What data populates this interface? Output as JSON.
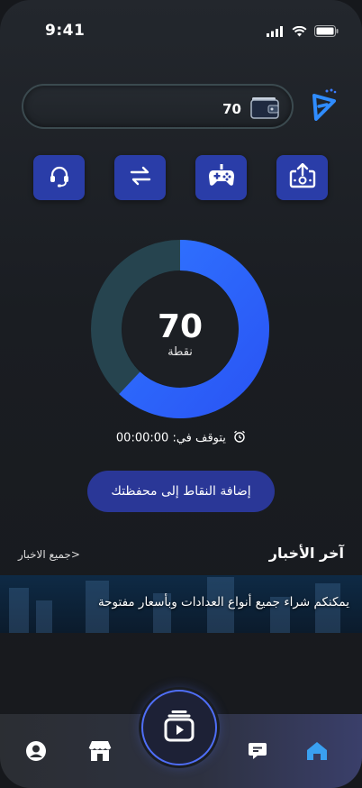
{
  "status_bar": {
    "time": "9:41"
  },
  "wallet": {
    "balance": "70"
  },
  "actions": [
    {
      "name": "support",
      "icon": "headset-icon"
    },
    {
      "name": "transfer",
      "icon": "transfer-arrows-icon"
    },
    {
      "name": "games",
      "icon": "gamepad-icon"
    },
    {
      "name": "upload",
      "icon": "upload-box-icon"
    }
  ],
  "points": {
    "value": "70",
    "unit": "نقطة",
    "fill_fraction": 0.62
  },
  "timer": {
    "label": "يتوقف في:",
    "value": "00:00:00"
  },
  "add_button": {
    "label": "إضافة النقاط إلى محفظتك"
  },
  "news": {
    "title": "آخر الأخبار",
    "all_link": "<جميع الاخبار",
    "banner_text": "يمكنكم شراء جميع أنواع العدادات وبأسعار مفتوحة"
  },
  "bottom_nav": [
    "home-icon",
    "chat-icon",
    "center-play-icon",
    "store-icon",
    "profile-icon"
  ],
  "colors": {
    "accent": "#2a3da8",
    "ring_fill": "#2f6bff",
    "ring_track": "#26444f",
    "home_active": "#3aa0f0"
  }
}
